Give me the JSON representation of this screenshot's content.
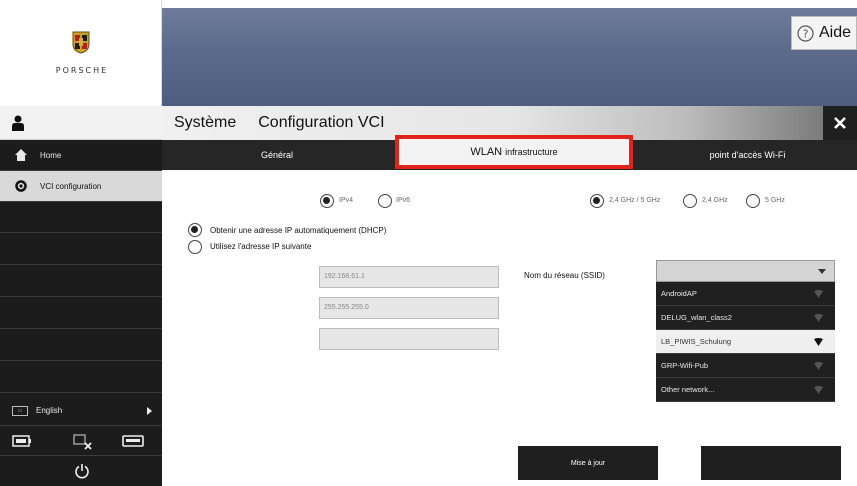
{
  "brand": {
    "logo_text": "PORSCHE",
    "crest_icon": "porsche-crest-icon"
  },
  "header": {
    "help_label": "Aide",
    "help_icon": "question-circle-icon"
  },
  "title_bar": {
    "system": "Système",
    "section": "Configuration VCI",
    "close_icon": "close-x-icon"
  },
  "tabs": [
    {
      "label": "Général",
      "active": false
    },
    {
      "label_big": "WLAN",
      "label_small": "infrastructure",
      "active": true
    },
    {
      "label": "point d'accès Wi-Fi",
      "active": false
    }
  ],
  "sidebar": {
    "user_icon": "user-icon",
    "items": [
      {
        "label": "Home",
        "icon": "home-icon",
        "selected": false
      },
      {
        "label": "VCI configuration",
        "icon": "gear-icon",
        "selected": true
      }
    ],
    "language": {
      "label": "English",
      "icon": "keyboard-icon"
    },
    "bottom_icons": [
      "battery-icon",
      "no-connection-icon",
      "vci-device-icon",
      "power-icon"
    ]
  },
  "main": {
    "ip_version": {
      "options": [
        "IPv4",
        "IPv6"
      ],
      "selected": "IPv4"
    },
    "band": {
      "options": [
        "2,4 GHz / 5 GHz",
        "2,4 GHz",
        "5 GHz"
      ],
      "selected": "2,4 GHz / 5 GHz"
    },
    "address_mode": {
      "options": [
        "Obtenir une adresse IP automatiquement (DHCP)",
        "Utilisez l'adresse IP suivante"
      ],
      "selected": "Obtenir une adresse IP automatiquement (DHCP)"
    },
    "fields": {
      "ip_address": "192.168.61.1",
      "subnet_mask": "255.255.255.0",
      "gateway": ""
    },
    "ssid": {
      "label": "Nom du réseau (SSID)",
      "selected_value": "",
      "options": [
        {
          "name": "AndroidAP",
          "selected": false
        },
        {
          "name": "DELUG_wlan_class2",
          "selected": false
        },
        {
          "name": "LB_PIWIS_Schulung",
          "selected": true
        },
        {
          "name": "GRP-Wifi-Pub",
          "selected": false
        },
        {
          "name": "Other network...",
          "selected": false
        }
      ]
    },
    "update_button": "Mise à jour"
  }
}
